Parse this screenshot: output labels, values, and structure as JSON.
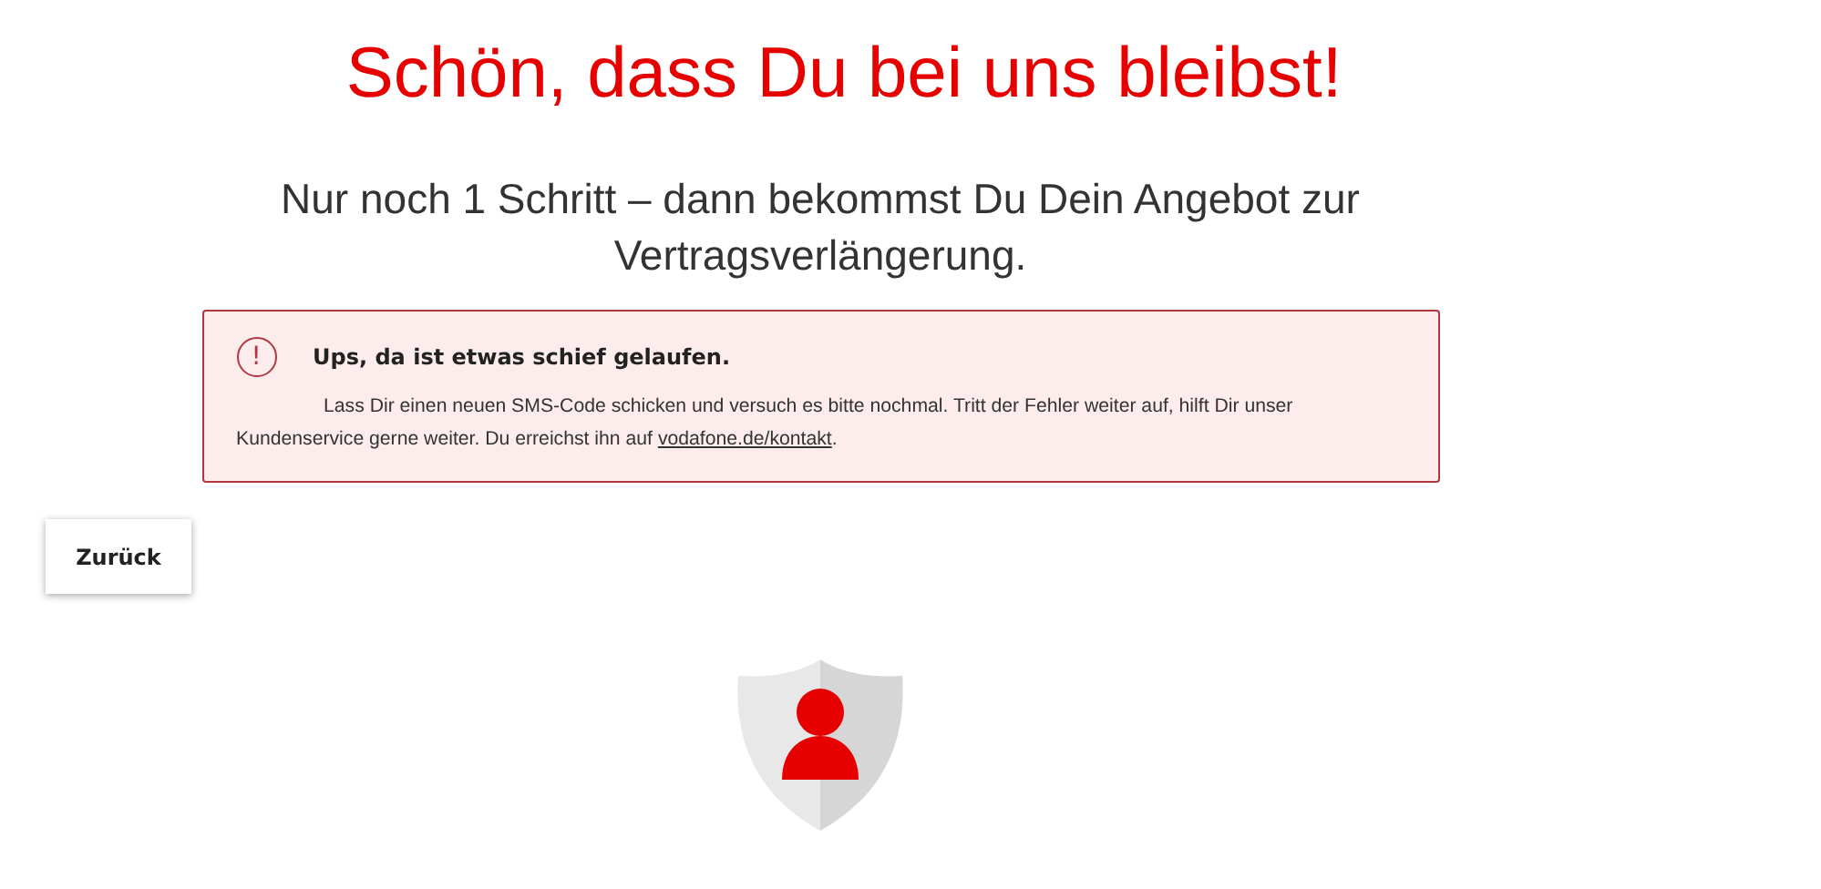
{
  "title": "Schön, dass Du bei uns bleibst!",
  "subtitle": "Nur noch 1 Schritt – dann bekommst Du Dein Angebot zur Vertragsverlängerung.",
  "alert": {
    "icon": "!",
    "heading": "Ups, da ist etwas schief gelaufen.",
    "text_before": "Lass Dir einen neuen SMS-Code  schicken und versuch es bitte nochmal. Tritt der Fehler weiter auf, hilft Dir unser Kundenservice gerne weiter. Du erreichst ihn auf",
    "link": "vodafone.de/kontakt",
    "text_after": "."
  },
  "back_button": {
    "label": "Zurück"
  }
}
